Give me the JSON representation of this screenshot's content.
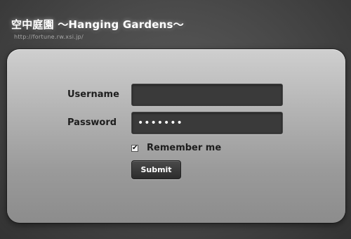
{
  "header": {
    "title": "空中庭園 〜Hanging Gardens〜",
    "url": "http://fortune.rw.xsi.jp/"
  },
  "form": {
    "username_label": "Username",
    "username_value": "",
    "password_label": "Password",
    "password_value": "•••••••",
    "remember_label": "Remember me",
    "remember_checked": true,
    "remember_check_glyph": "✔",
    "submit_label": "Submit"
  },
  "colors": {
    "background": "#4a4a4a",
    "panel_top": "#cfcfcf",
    "panel_bottom": "#8c8c8c",
    "field_background": "#3a3a3a",
    "button_background": "#2c2c2c",
    "title_text": "#ffffff"
  }
}
